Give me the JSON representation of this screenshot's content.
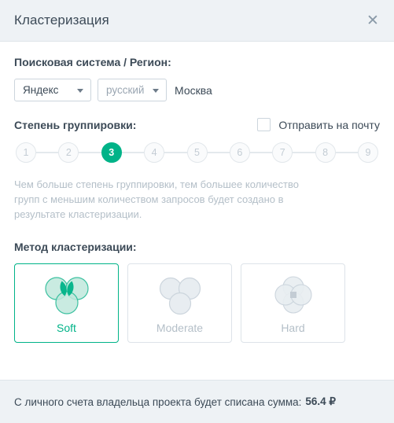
{
  "header": {
    "title": "Кластеризация",
    "close_icon": "close-icon"
  },
  "search_engine_section": {
    "label": "Поисковая система / Регион:",
    "engine_select": {
      "value": "Яндекс",
      "caret_icon": "chevron-down-icon"
    },
    "language_select": {
      "value": "русский",
      "caret_icon": "chevron-down-icon"
    },
    "region": "Москва"
  },
  "grouping_section": {
    "label": "Степень группировки:",
    "email_checkbox": {
      "label": "Отправить на почту",
      "checked": false
    },
    "steps": [
      "1",
      "2",
      "3",
      "4",
      "5",
      "6",
      "7",
      "8",
      "9"
    ],
    "selected_step": "3",
    "hint": "Чем больше степень группировки, тем большее количество групп с меньшим количеством запросов будет создано в результате кластеризации."
  },
  "method_section": {
    "label": "Метод кластеризации:",
    "cards": [
      {
        "label": "Soft",
        "icon": "venn-three-circles-overlap-icon",
        "selected": true
      },
      {
        "label": "Moderate",
        "icon": "venn-three-circles-tangent-icon",
        "selected": false
      },
      {
        "label": "Hard",
        "icon": "venn-four-circles-rosette-icon",
        "selected": false
      }
    ]
  },
  "footer": {
    "text": "С личного счета владельца проекта будет списана сумма:",
    "amount": "56.4 ₽"
  },
  "colors": {
    "accent": "#00b388",
    "accent_light": "#bfe8dc",
    "panel_bg": "#eef2f5",
    "text": "#3c4a57",
    "muted": "#b4bfc8"
  }
}
